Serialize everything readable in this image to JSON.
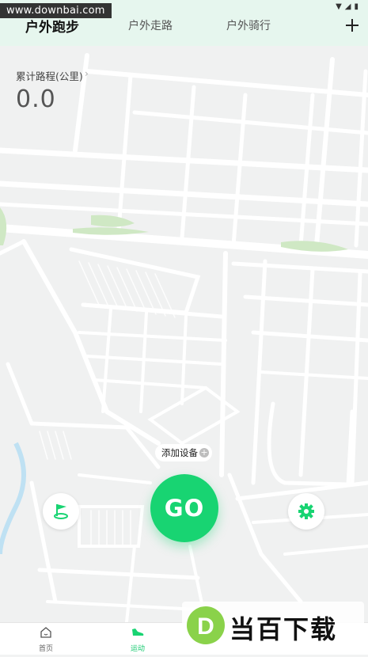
{
  "status_bar": {
    "watermark": "www.downbai.com"
  },
  "tabs": [
    {
      "label": "户外跑步",
      "active": true
    },
    {
      "label": "户外走路",
      "active": false
    },
    {
      "label": "户外骑行",
      "active": false
    }
  ],
  "distance": {
    "label": "累计路程(公里)",
    "value": "0.0"
  },
  "add_device": {
    "label": "添加设备"
  },
  "go_button": {
    "label": "GO"
  },
  "bottom_nav": {
    "items": [
      {
        "label": "首页",
        "icon": "home-icon",
        "active": false
      },
      {
        "label": "运动",
        "icon": "shoe-icon",
        "active": true
      }
    ]
  },
  "watermark_logo": {
    "text": "当百下载",
    "letter": "D"
  },
  "colors": {
    "accent": "#18d472",
    "header_bg": "#e6f6ee",
    "map_road": "#ffffff",
    "map_park": "#cfe8c4"
  }
}
